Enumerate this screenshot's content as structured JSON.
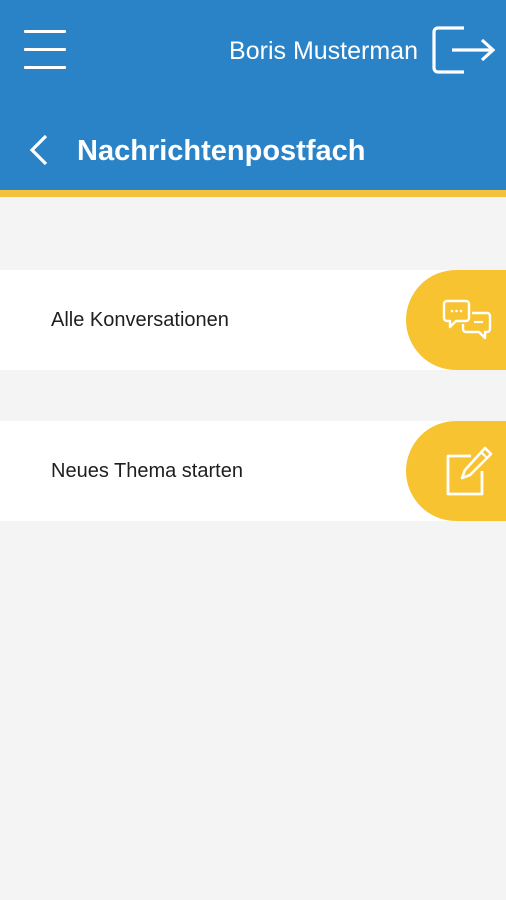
{
  "header": {
    "user_name": "Boris Musterman",
    "title": "Nachrichtenpostfach",
    "menu_icon": "hamburger-menu-icon",
    "logout_icon": "logout-icon",
    "back_icon": "chevron-left-icon"
  },
  "menu": {
    "items": [
      {
        "label": "Alle Konversationen",
        "icon": "chat-bubbles-icon"
      },
      {
        "label": "Neues Thema starten",
        "icon": "edit-icon"
      }
    ]
  },
  "colors": {
    "header_blue": "#2a83c7",
    "accent_yellow": "#f3c23d",
    "background": "#f4f4f4",
    "row_background": "#ffffff"
  }
}
